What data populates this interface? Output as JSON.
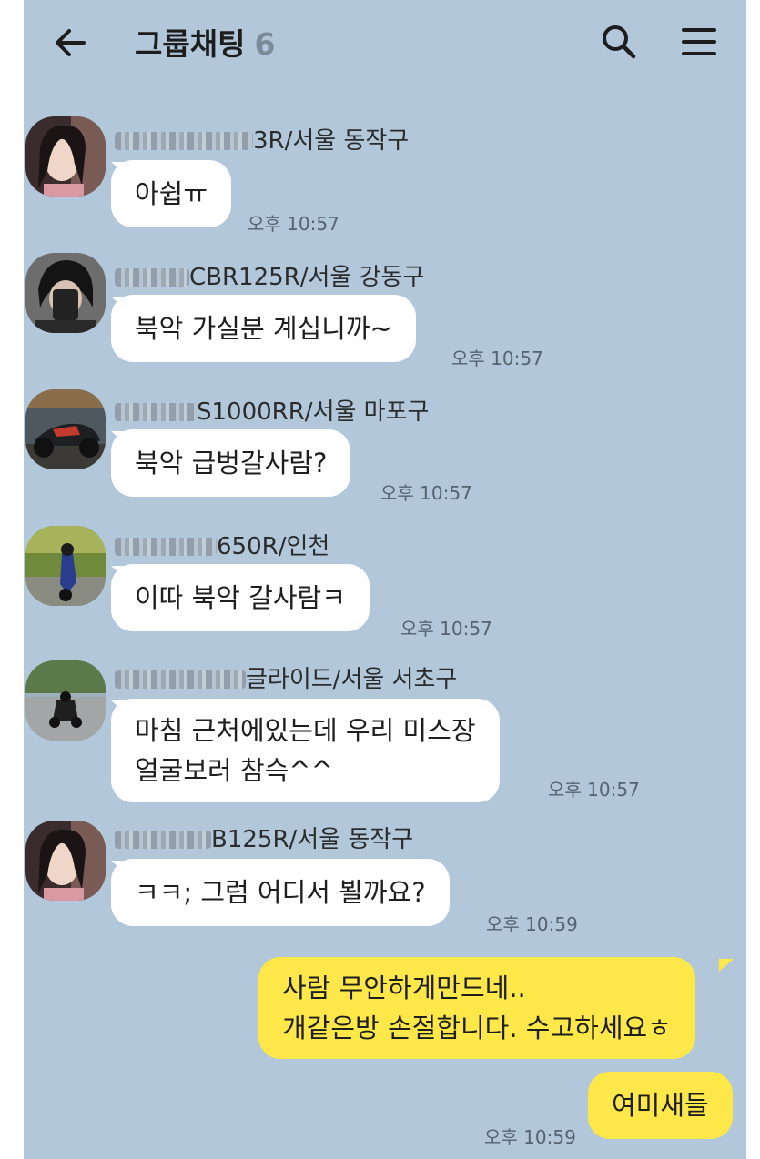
{
  "header": {
    "title": "그룹채팅",
    "member_count": "6"
  },
  "messages": [
    {
      "sender_visible": "3R/서울 동작구",
      "text": "아쉽ㅠ",
      "time": "오후 10:57",
      "avatar": "woman-portrait"
    },
    {
      "sender_visible": "CBR125R/서울 강동구",
      "text": "북악 가실분 계십니까~",
      "time": "오후 10:57",
      "avatar": "man-mirror-selfie"
    },
    {
      "sender_visible": "S1000RR/서울 마포구",
      "text": "북악 급벙갈사람?",
      "time": "오후 10:57",
      "avatar": "motorcycle-dark"
    },
    {
      "sender_visible": "650R/인천",
      "text": "이따 북악 갈사람ㅋ",
      "time": "오후 10:57",
      "avatar": "motorcycle-trees"
    },
    {
      "sender_visible": "글라이드/서울 서초구",
      "text_lines": [
        "마침 근처에있는데 우리 미스장",
        "얼굴보러 참슥^^"
      ],
      "time": "오후 10:57",
      "avatar": "motorcycle-road"
    },
    {
      "sender_visible": "B125R/서울 동작구",
      "text": "ㅋㅋ; 그럼 어디서 뵐까요?",
      "time": "오후 10:59",
      "avatar": "woman-portrait"
    }
  ],
  "my_messages": [
    {
      "text_lines": [
        "사람 무안하게만드네..",
        "개같은방 손절합니다. 수고하세요ㅎ"
      ]
    },
    {
      "text": "여미새들",
      "time": "오후 10:59"
    }
  ],
  "colors": {
    "chat_bg": "#b2c7da",
    "my_bubble": "#fee749",
    "their_bubble": "#ffffff"
  },
  "icons": [
    "back-arrow-icon",
    "search-icon",
    "menu-icon"
  ]
}
